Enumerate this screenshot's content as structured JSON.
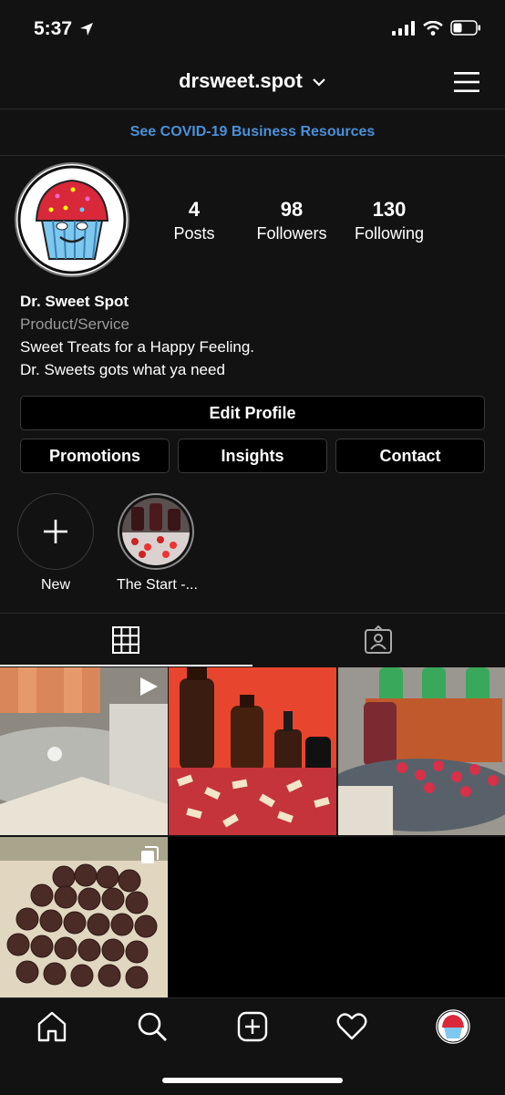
{
  "status_bar": {
    "time": "5:37"
  },
  "header": {
    "username": "drsweet.spot"
  },
  "banner": {
    "text": "See COVID-19 Business Resources"
  },
  "profile": {
    "stats": [
      {
        "value": "4",
        "label": "Posts"
      },
      {
        "value": "98",
        "label": "Followers"
      },
      {
        "value": "130",
        "label": "Following"
      }
    ],
    "name": "Dr. Sweet Spot",
    "category": "Product/Service",
    "bio_line1": "Sweet Treats for a Happy Feeling.",
    "bio_line2": "Dr. Sweets gots what ya need"
  },
  "buttons": {
    "edit_profile": "Edit Profile",
    "promotions": "Promotions",
    "insights": "Insights",
    "contact": "Contact"
  },
  "highlights": [
    {
      "label": "New"
    },
    {
      "label": "The Start -..."
    }
  ],
  "colors": {
    "background": "#121212",
    "link_blue": "#4a90d9",
    "heart_red": "#d0202a"
  }
}
